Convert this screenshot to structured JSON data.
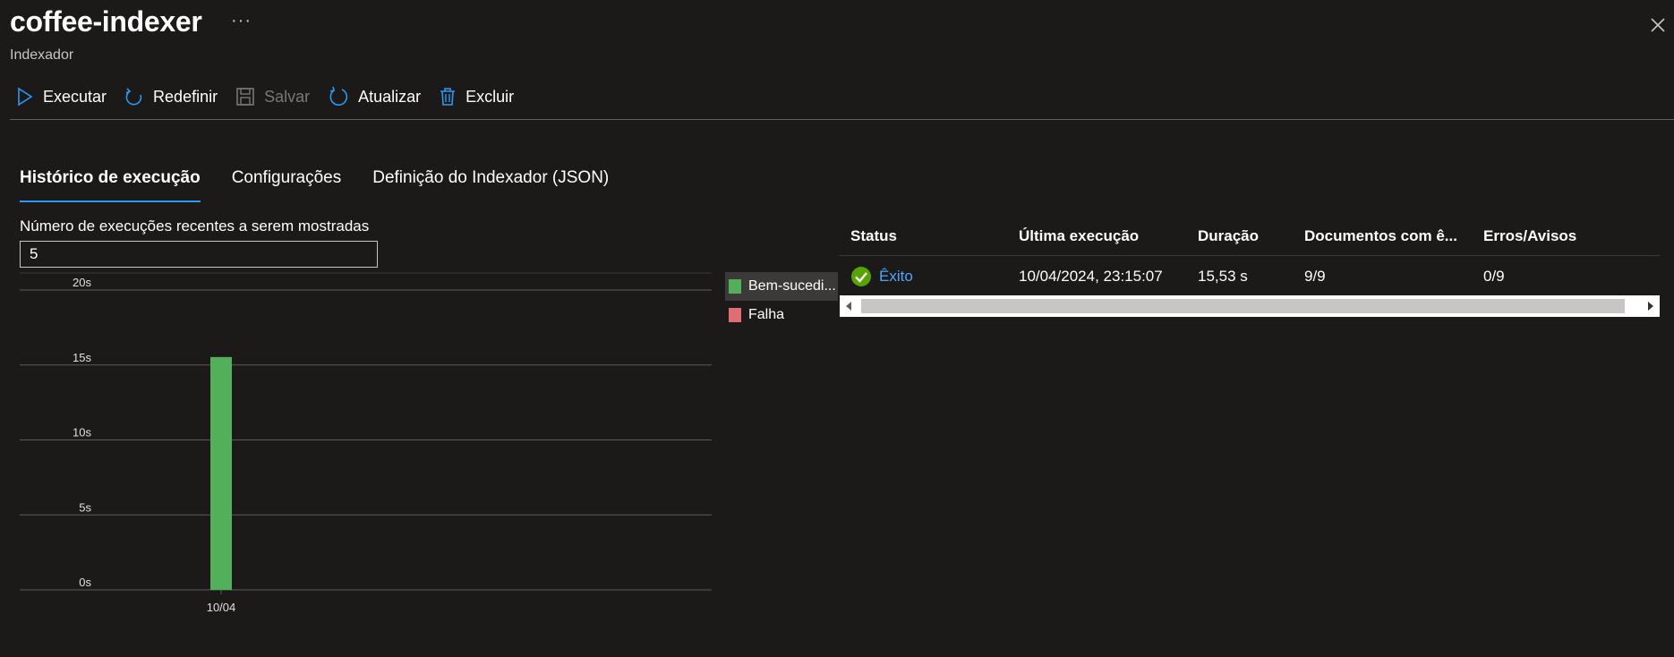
{
  "header": {
    "title": "coffee-indexer",
    "subtitle": "Indexador",
    "more": "···"
  },
  "toolbar": [
    {
      "label": "Executar",
      "icon": "play-icon",
      "disabled": false
    },
    {
      "label": "Redefinir",
      "icon": "reset-icon",
      "disabled": false
    },
    {
      "label": "Salvar",
      "icon": "save-icon",
      "disabled": true
    },
    {
      "label": "Atualizar",
      "icon": "refresh-icon",
      "disabled": false
    },
    {
      "label": "Excluir",
      "icon": "delete-icon",
      "disabled": false
    }
  ],
  "tabs": [
    {
      "label": "Histórico de execução",
      "active": true
    },
    {
      "label": "Configurações",
      "active": false
    },
    {
      "label": "Definição do Indexador (JSON)",
      "active": false
    }
  ],
  "recent_runs": {
    "label": "Número de execuções recentes a serem mostradas",
    "value": "5"
  },
  "colors": {
    "accent": "#2899f5",
    "success": "#52b05a",
    "failure": "#e06c75",
    "background": "#1b1a19"
  },
  "chart_data": {
    "type": "bar",
    "categories": [
      "10/04"
    ],
    "series": [
      {
        "name": "Bem-sucedi...",
        "color": "#52b05a",
        "values": [
          15.53
        ]
      },
      {
        "name": "Falha",
        "color": "#e06c75",
        "values": [
          0
        ]
      }
    ],
    "yticks": [
      "0s",
      "5s",
      "10s",
      "15s",
      "20s"
    ],
    "ylim": [
      0,
      20
    ],
    "grid": true,
    "legend": "right"
  },
  "table": {
    "columns": [
      "Status",
      "Última execução",
      "Duração",
      "Documentos com ê...",
      "Erros/Avisos"
    ],
    "rows": [
      {
        "status": "Êxito",
        "status_icon": "success-check-icon",
        "last_run": "10/04/2024, 23:15:07",
        "duration": "15,53 s",
        "documents": "9/9",
        "errors": "0/9"
      }
    ]
  }
}
